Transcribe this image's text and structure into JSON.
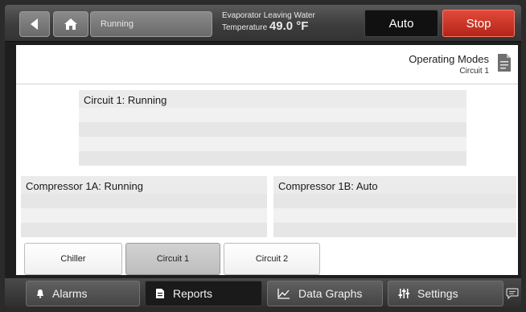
{
  "header": {
    "status": "Running",
    "ewt_line1": "Evaporator Leaving Water",
    "ewt_line2_prefix": "Temperature ",
    "ewt_value": "49.0 °F",
    "auto_label": "Auto",
    "stop_label": "Stop",
    "back_icon": "back-arrow-icon",
    "home_icon": "home-icon"
  },
  "content": {
    "mode_title": "Operating Modes",
    "mode_subtitle": "Circuit 1",
    "doc_icon": "document-icon",
    "circuit_panel_title": "Circuit 1:  Running",
    "compressor_a_title": "Compressor 1A:  Running",
    "compressor_b_title": "Compressor 1B:  Auto",
    "tabs": [
      {
        "label": "Chiller",
        "active": false
      },
      {
        "label": "Circuit 1",
        "active": true
      },
      {
        "label": "Circuit 2",
        "active": false
      }
    ]
  },
  "nav": {
    "items": [
      {
        "label": "Alarms",
        "icon": "bell-icon"
      },
      {
        "label": "Reports",
        "icon": "report-icon"
      },
      {
        "label": "Data Graphs",
        "icon": "graph-icon"
      },
      {
        "label": "Settings",
        "icon": "sliders-icon"
      }
    ],
    "selected": "Reports",
    "chat_icon": "chat-icon"
  },
  "colors": {
    "stop_red": "#c9301f",
    "auto_black": "#111111",
    "panel_bg": "#ffffff"
  }
}
